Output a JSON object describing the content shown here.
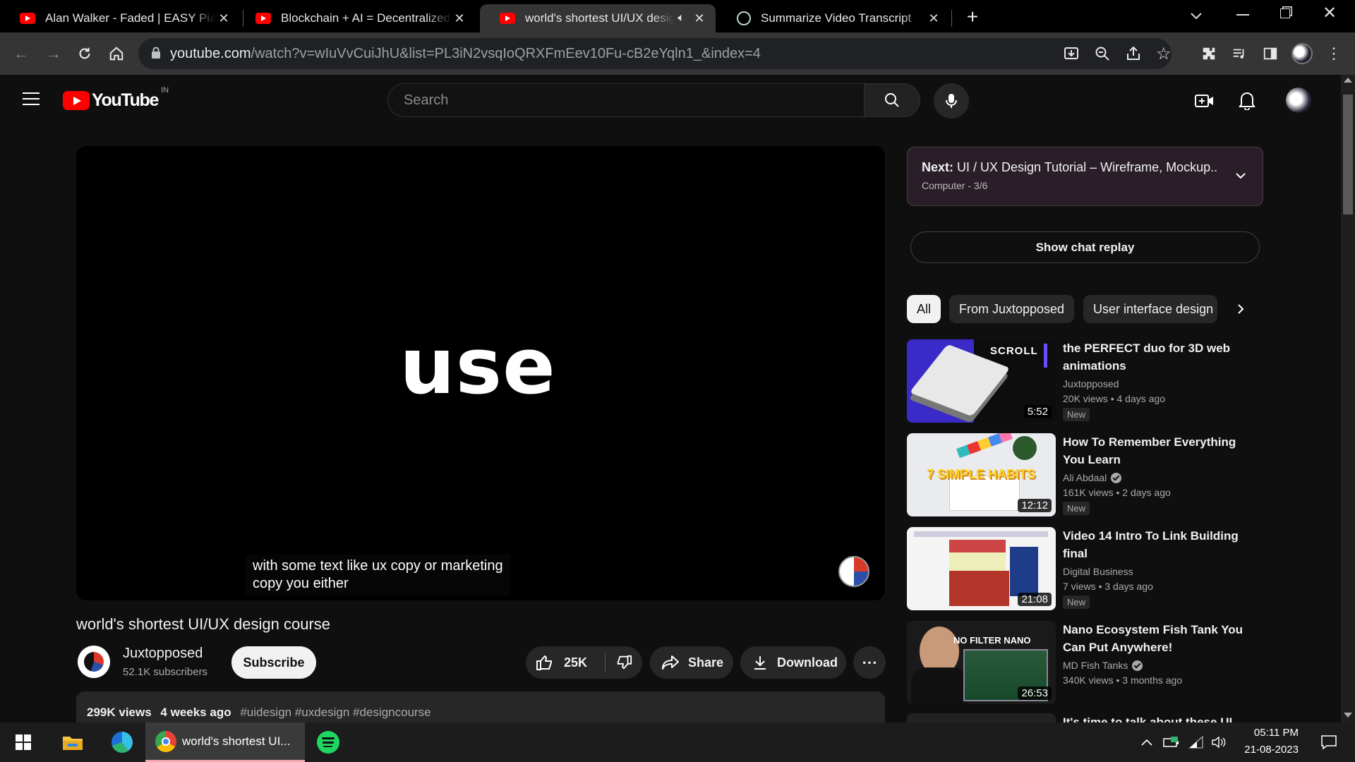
{
  "tabs": [
    {
      "title": "Alan Walker - Faded | EASY Piano",
      "icon": "youtube-icon"
    },
    {
      "title": "Blockchain + AI = Decentralized A",
      "icon": "youtube-icon"
    },
    {
      "title": "world's shortest UI/UX design",
      "icon": "youtube-icon",
      "muted_icon": "speaker-icon"
    },
    {
      "title": "Summarize Video Transcript",
      "icon": "chatgpt-icon"
    }
  ],
  "address": {
    "host": "youtube.com",
    "path": "/watch?v=wIuVvCuiJhU&list=PL3iN2vsqIoQRXFmEev10Fu-cB2eYqln1_&index=4"
  },
  "youtube": {
    "logo_text": "YouTube",
    "region": "IN",
    "search_placeholder": "Search"
  },
  "player": {
    "big_word": "use",
    "caption_line1": "with some text like ux copy or marketing",
    "caption_line2": "copy you either"
  },
  "video": {
    "title": "world's shortest UI/UX design course",
    "channel": "Juxtopposed",
    "subscribers": "52.1K subscribers",
    "subscribe_label": "Subscribe",
    "likes": "25K",
    "share_label": "Share",
    "download_label": "Download",
    "views": "299K views",
    "age": "4 weeks ago",
    "tags": "#uidesign #uxdesign #designcourse"
  },
  "sidebar": {
    "next_prefix": "Next:",
    "next_title": "UI / UX Design Tutorial – Wireframe, Mockup...",
    "next_sub": "Computer - 3/6",
    "chat_replay": "Show chat replay",
    "chips": [
      "All",
      "From Juxtopposed",
      "User interface design"
    ],
    "recs": [
      {
        "title": "the PERFECT duo for 3D web animations",
        "channel": "Juxtopposed",
        "verified": false,
        "meta": "20K views  • 4 days ago",
        "badge": "New",
        "duration": "5:52",
        "thumb_text": "SCROLL"
      },
      {
        "title": "How To Remember Everything You Learn",
        "channel": "Ali Abdaal",
        "verified": true,
        "meta": "161K views  • 2 days ago",
        "badge": "New",
        "duration": "12:12",
        "thumb_text": "7 SIMPLE HABITS"
      },
      {
        "title": "Video 14 Intro To Link Building final",
        "channel": "Digital Business",
        "verified": false,
        "meta": "7 views  • 3 days ago",
        "badge": "New",
        "duration": "21:08",
        "thumb_text": ""
      },
      {
        "title": "Nano Ecosystem Fish Tank You Can Put Anywhere!",
        "channel": "MD Fish Tanks",
        "verified": true,
        "meta": "340K views  • 3 months ago",
        "badge": "",
        "duration": "26:53",
        "thumb_text": "NO FILTER NANO"
      },
      {
        "title": "It's time to talk about these UI",
        "channel": "",
        "verified": false,
        "meta": "",
        "badge": "",
        "duration": "",
        "thumb_text": ""
      }
    ]
  },
  "taskbar": {
    "active_app": "world's shortest UI...",
    "time": "05:11 PM",
    "date": "21-08-2023"
  },
  "colors": {
    "yt_red": "#ff0000",
    "page_bg": "#0f0f0f",
    "chrome_toolbar": "#353535"
  }
}
